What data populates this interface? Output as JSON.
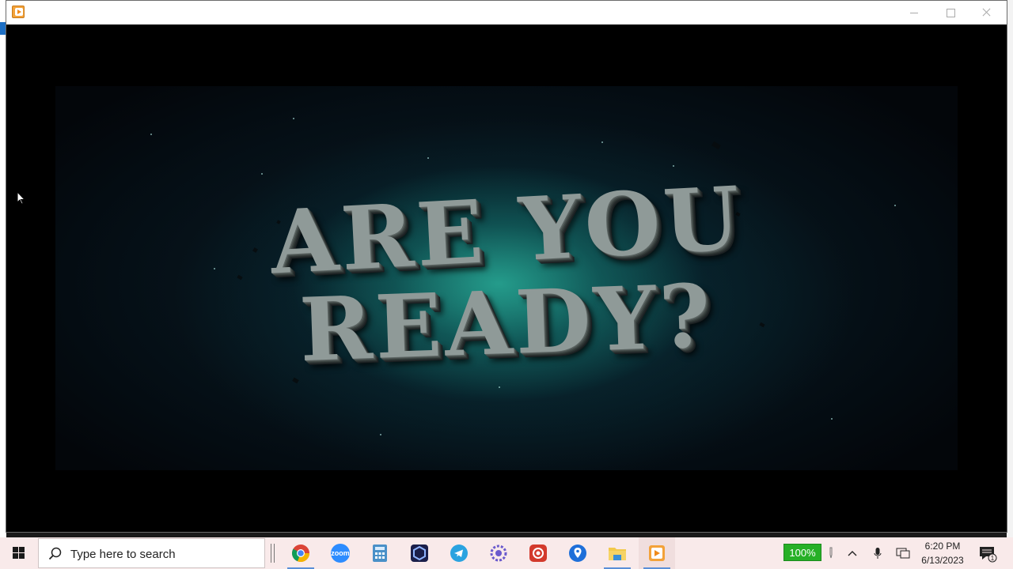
{
  "window": {
    "app_icon": "media-player-icon",
    "controls": [
      "minimize",
      "maximize",
      "close"
    ]
  },
  "video": {
    "line1": "ARE YOU",
    "line2": "READY?"
  },
  "taskbar": {
    "search_placeholder": "Type here to search",
    "apps": [
      {
        "name": "chrome",
        "icon": "chrome-icon"
      },
      {
        "name": "zoom",
        "icon": "zoom-icon",
        "label": "zoom"
      },
      {
        "name": "calculator",
        "icon": "calculator-icon"
      },
      {
        "name": "app-hex",
        "icon": "hexagon-app-icon"
      },
      {
        "name": "telegram",
        "icon": "telegram-icon"
      },
      {
        "name": "app-gear",
        "icon": "gear-app-icon"
      },
      {
        "name": "app-record",
        "icon": "record-app-icon"
      },
      {
        "name": "maps",
        "icon": "map-pin-icon"
      },
      {
        "name": "file-explorer",
        "icon": "folder-icon"
      },
      {
        "name": "media-player",
        "icon": "media-player-icon"
      }
    ],
    "battery": "100%",
    "time": "6:20 PM",
    "date": "6/13/2023",
    "notification_count": "1"
  },
  "colors": {
    "taskbar_bg": "#f9eaea",
    "battery_green": "#27b027",
    "accent_teal": "#1e8f86"
  }
}
